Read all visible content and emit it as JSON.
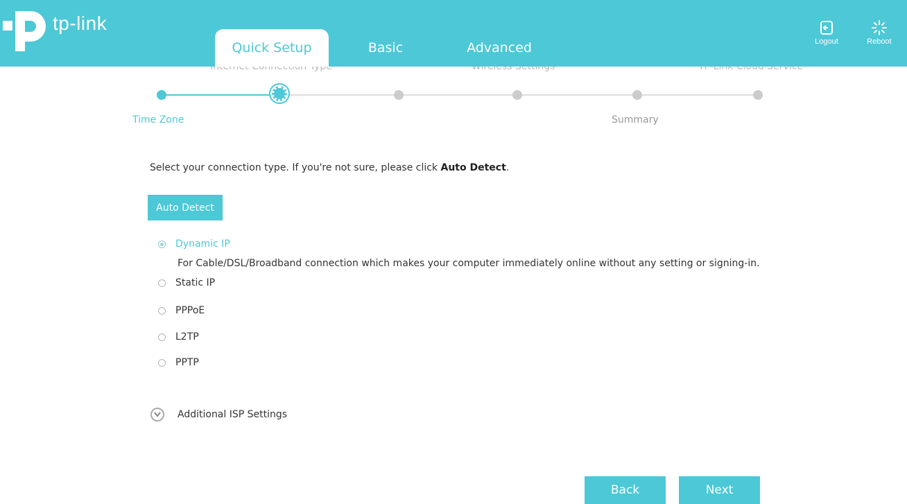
{
  "brand": {
    "name": "tp-link"
  },
  "nav": {
    "tabs": [
      {
        "label": "Quick Setup",
        "active": true
      },
      {
        "label": "Basic",
        "active": false
      },
      {
        "label": "Advanced",
        "active": false
      }
    ],
    "logout_label": "Logout",
    "reboot_label": "Reboot"
  },
  "steps": {
    "top_labels": [
      "Internet Connection Type",
      "Wireless Settings",
      "TP-Link Cloud Service"
    ],
    "bottom_labels": [
      "Time Zone",
      "Summary"
    ],
    "total": 6,
    "current_index": 1
  },
  "content": {
    "intro_prefix": "Select your connection type. If you're not sure, please click ",
    "intro_bold": "Auto Detect",
    "intro_suffix": ".",
    "auto_detect_label": "Auto Detect",
    "options": [
      {
        "label": "Dynamic IP",
        "checked": true
      },
      {
        "label": "Static IP",
        "checked": false
      },
      {
        "label": "PPPoE",
        "checked": false
      },
      {
        "label": "L2TP",
        "checked": false
      },
      {
        "label": "PPTP",
        "checked": false
      }
    ],
    "dynamic_ip_description": "For Cable/DSL/Broadband connection which makes your computer immediately online without any setting or signing-in.",
    "additional_label": "Additional ISP Settings"
  },
  "footer": {
    "back_label": "Back",
    "next_label": "Next"
  },
  "colors": {
    "accent": "#4cc8d6",
    "inactive": "#cccccc"
  }
}
